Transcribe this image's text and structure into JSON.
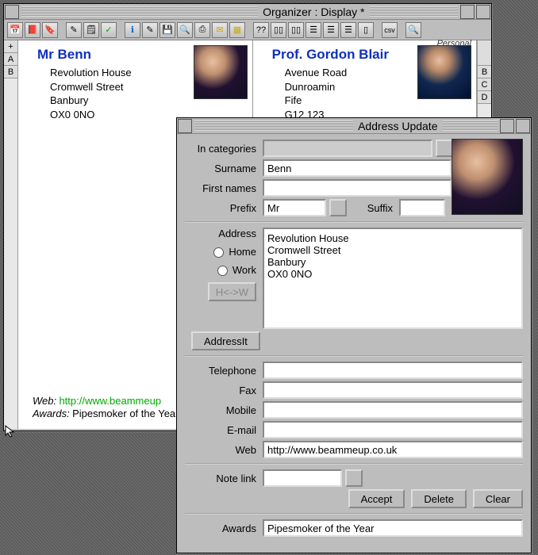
{
  "organizer": {
    "title": "Organizer : Display *",
    "tabs_left": [
      "+",
      "A",
      "B"
    ],
    "tabs_right": [
      "B",
      "C",
      "D"
    ],
    "card1": {
      "name": "Mr Benn",
      "addr1": "Revolution House",
      "addr2": "Cromwell Street",
      "addr3": "Banbury",
      "addr4": "OX0 0NO",
      "web_label": "Web:",
      "web_url": "http://www.beammeup",
      "awards_label": "Awards:",
      "awards_val": "Pipesmoker of the Yea"
    },
    "card2": {
      "tag": "Personal",
      "name": "Prof. Gordon Blair",
      "addr1": "Avenue Road",
      "addr2": "Dunroamin",
      "addr3": "Fife",
      "addr4": "G12 123"
    }
  },
  "update": {
    "title": "Address Update",
    "labels": {
      "categories": "In categories",
      "surname": "Surname",
      "firstnames": "First names",
      "prefix": "Prefix",
      "suffix": "Suffix",
      "address": "Address",
      "home": "Home",
      "work": "Work",
      "hw": "H<->W",
      "addressit": "AddressIt",
      "telephone": "Telephone",
      "fax": "Fax",
      "mobile": "Mobile",
      "email": "E-mail",
      "web": "Web",
      "notelink": "Note link",
      "accept": "Accept",
      "delete": "Delete",
      "clear": "Clear",
      "awards": "Awards"
    },
    "values": {
      "categories": "",
      "surname": "Benn",
      "firstnames": "",
      "prefix": "Mr",
      "suffix": "",
      "address": "Revolution House\nCromwell Street\nBanbury\nOX0 0NO",
      "telephone": "",
      "fax": "",
      "mobile": "",
      "email": "",
      "web": "http://www.beammeup.co.uk",
      "notelink": "",
      "awards": "Pipesmoker of the Year"
    }
  }
}
